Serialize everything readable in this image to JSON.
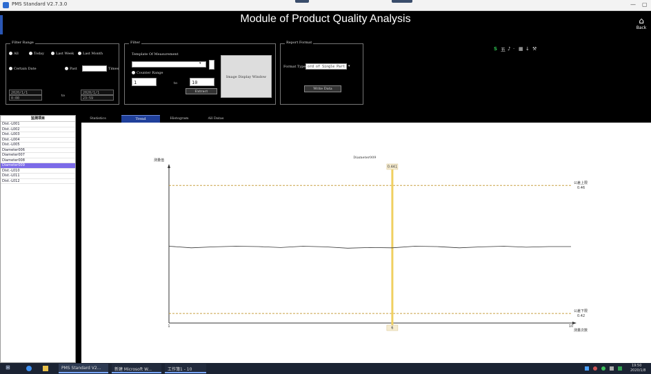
{
  "window": {
    "title": "PMS Standard V2.7.3.0",
    "minimize": "—",
    "restore": "▢"
  },
  "header": {
    "title": "Module of Product Quality Analysis",
    "home_label": "Back",
    "home_icon": "house-icon"
  },
  "filter_range": {
    "title": "Filter Range",
    "options": [
      "All",
      "Today",
      "Last Week",
      "Last Month"
    ],
    "certain_date_label": "Certain Date",
    "past_label": "Past",
    "past_value": "",
    "past_unit": "Times",
    "date_from": "2020/1/1",
    "time_from": "0:00",
    "to_label": "to",
    "date_to": "2020/1/1",
    "time_to": "23:59"
  },
  "filter": {
    "title": "Filter",
    "template_label": "Template Of Measurement",
    "template_value": "",
    "counter_range_label": "Counter Range",
    "counter_from": "1",
    "to_label": "to",
    "counter_to": "10",
    "extract_button": "Extract",
    "image_display_button": "Image Display Window"
  },
  "report_format": {
    "title": "Report Format",
    "format_type_label": "Format Type",
    "format_type_value": "ord of Single Part",
    "write_button": "Write Data"
  },
  "toolbar_icons": [
    "S",
    "五",
    "♪",
    "·",
    "▦",
    "↓",
    "⚒"
  ],
  "item_list": {
    "header": "监测项目",
    "items": [
      "Dist.-L001",
      "Dist.-L002",
      "Dist.-L003",
      "Dist.-L004",
      "Dist.-L005",
      "Diameter006",
      "Diameter007",
      "Diameter008",
      "Diameter009",
      "Dist.-L010",
      "Dist.-L011",
      "Dist.-L012"
    ],
    "selected_index": 8
  },
  "tabs": [
    {
      "label": "Statistics",
      "active": false
    },
    {
      "label": "Trend",
      "active": true
    },
    {
      "label": "Histogram",
      "active": false
    },
    {
      "label": "All Datas",
      "active": false
    }
  ],
  "chart_data": {
    "type": "line",
    "title": "Diameter009",
    "ylabel": "测量值",
    "xlabel": "测量次数",
    "x_ticks": [
      "1",
      "10"
    ],
    "upper_limit_label": "公差上限",
    "upper_limit_value": "0.46",
    "lower_limit_label": "公差下限",
    "lower_limit_value": "0.42",
    "cursor_value_label": "0.441",
    "cursor_x_label": "6",
    "cursor_x": 6,
    "xlim": [
      1,
      10
    ],
    "ylim": [
      0.417,
      0.465
    ],
    "upper_limit": 0.46,
    "lower_limit": 0.42,
    "x": [
      1,
      1.5,
      2,
      2.5,
      3,
      3.5,
      4,
      4.5,
      5,
      5.5,
      6,
      6.5,
      7,
      7.5,
      8,
      8.5,
      9,
      9.5,
      10
    ],
    "values": [
      0.441,
      0.4405,
      0.4408,
      0.441,
      0.4409,
      0.4406,
      0.441,
      0.4408,
      0.4404,
      0.4406,
      0.4405,
      0.441,
      0.4409,
      0.4405,
      0.4408,
      0.441,
      0.4407,
      0.4409,
      0.4409
    ],
    "series_color": "#333333",
    "limit_color": "#c8a040",
    "cursor_color": "#f0d060"
  },
  "taskbar": {
    "items": [
      "PMS Standard V2...",
      "新建 Microsoft W...",
      "工作簿1 - 10"
    ],
    "clock_time": "19:50",
    "clock_date": "2020/1/8"
  }
}
